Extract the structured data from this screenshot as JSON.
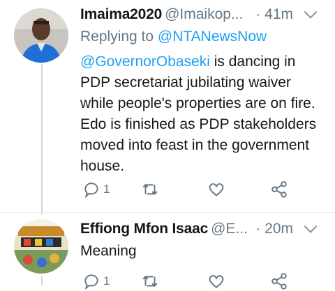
{
  "tweets": [
    {
      "name": "Imaima2020",
      "handle": "@Imaikop...",
      "time": "41m",
      "time_dot": "·",
      "replying_prefix": "Replying to ",
      "replying_to": "@NTANewsNow",
      "mention": "@GovernorObaseki",
      "text": " is dancing in PDP secretariat jubilating waiver while people's properties are on fire. Edo is finished as PDP stakeholders moved into feast in the government house.",
      "reply_count": "1",
      "icons": [
        "reply-icon",
        "retweet-icon",
        "like-icon",
        "share-icon"
      ]
    },
    {
      "name": "Effiong Mfon Isaac",
      "handle": "@E...",
      "time": "20m",
      "time_dot": "·",
      "text": "Meaning",
      "reply_count": "1",
      "icons": [
        "reply-icon",
        "retweet-icon",
        "like-icon",
        "share-icon"
      ]
    }
  ],
  "colors": {
    "link": "#1da1f2",
    "secondary_text": "#657786",
    "thread_line": "#ccd6dd"
  }
}
